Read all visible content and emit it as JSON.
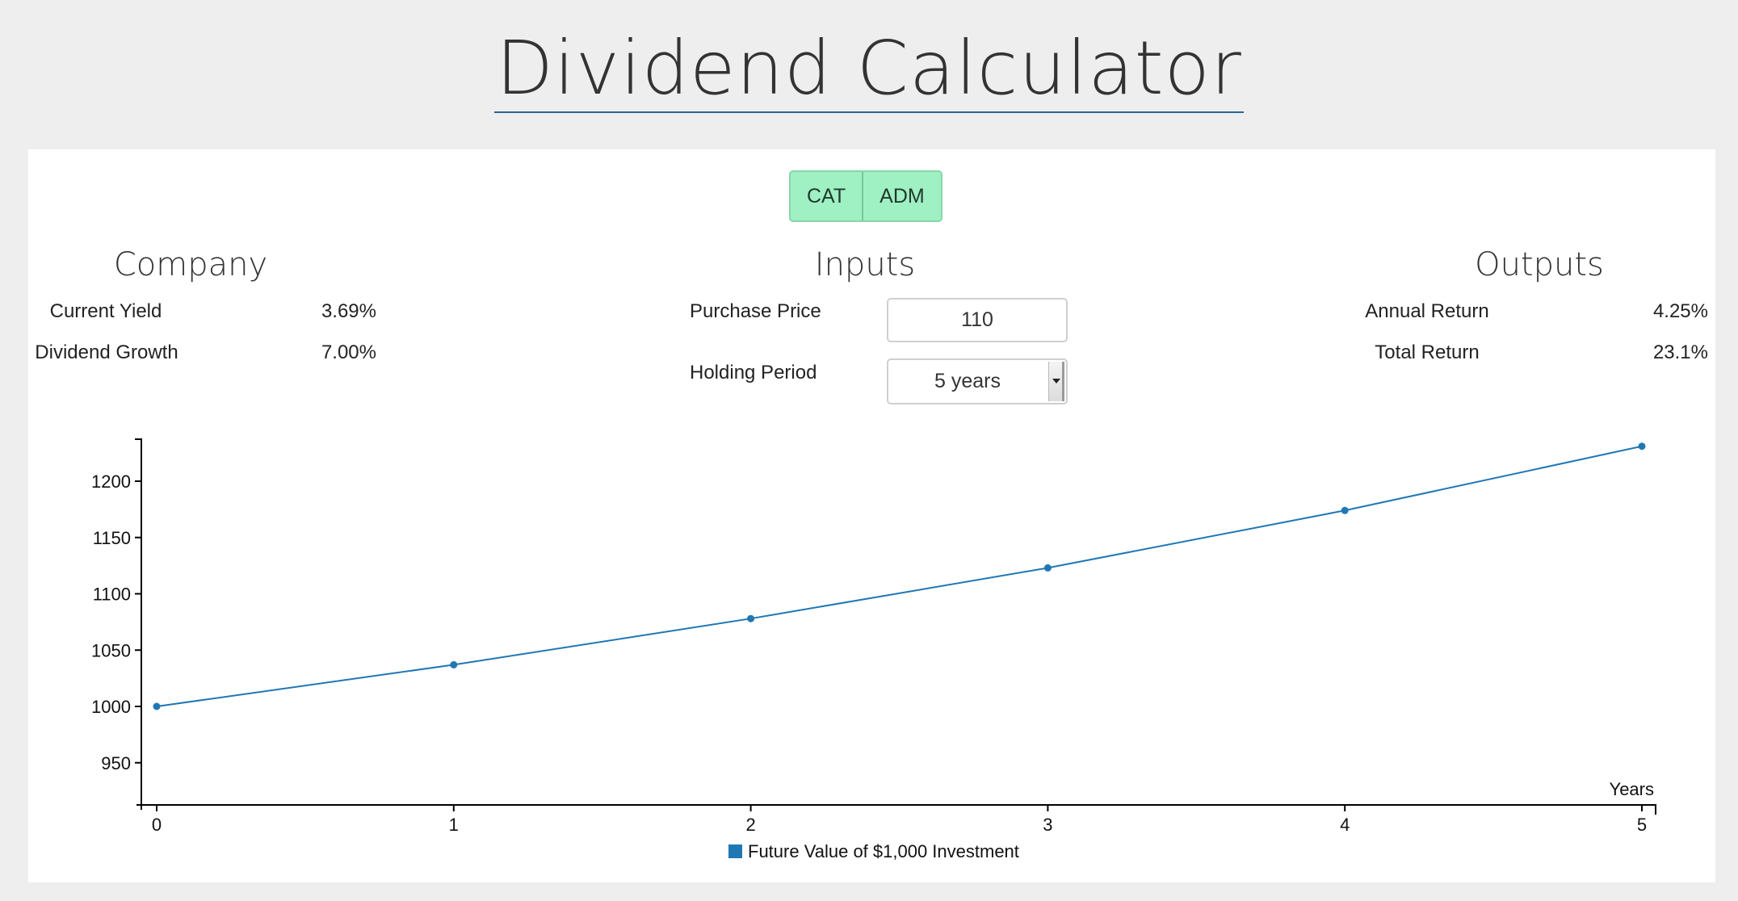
{
  "title": "Dividend Calculator",
  "tickers": [
    "CAT",
    "ADM"
  ],
  "company": {
    "heading": "Company",
    "current_yield_label": "Current Yield",
    "current_yield_value": "3.69%",
    "dividend_growth_label": "Dividend Growth",
    "dividend_growth_value": "7.00%"
  },
  "inputs": {
    "heading": "Inputs",
    "purchase_price_label": "Purchase Price",
    "purchase_price_value": "110",
    "holding_period_label": "Holding Period",
    "holding_period_value": "5 years"
  },
  "outputs": {
    "heading": "Outputs",
    "annual_return_label": "Annual Return",
    "annual_return_value": "4.25%",
    "total_return_label": "Total Return",
    "total_return_value": "23.1%"
  },
  "colors": {
    "series": "#1f77b4",
    "ticker_bg": "#9ff0c3"
  },
  "chart_data": {
    "type": "line",
    "x": [
      0,
      1,
      2,
      3,
      4,
      5
    ],
    "series": [
      {
        "name": "Future Value of $1,000 Investment",
        "values": [
          1000,
          1037,
          1078,
          1123,
          1174,
          1231
        ]
      }
    ],
    "xlabel": "Years",
    "ylabel": "",
    "xlim": [
      0,
      5
    ],
    "ylim": [
      930,
      1255
    ],
    "yticks": [
      950,
      1000,
      1050,
      1100,
      1150,
      1200
    ],
    "xticks": [
      0,
      1,
      2,
      3,
      4,
      5
    ],
    "grid": false,
    "legend": "bottom-center"
  }
}
